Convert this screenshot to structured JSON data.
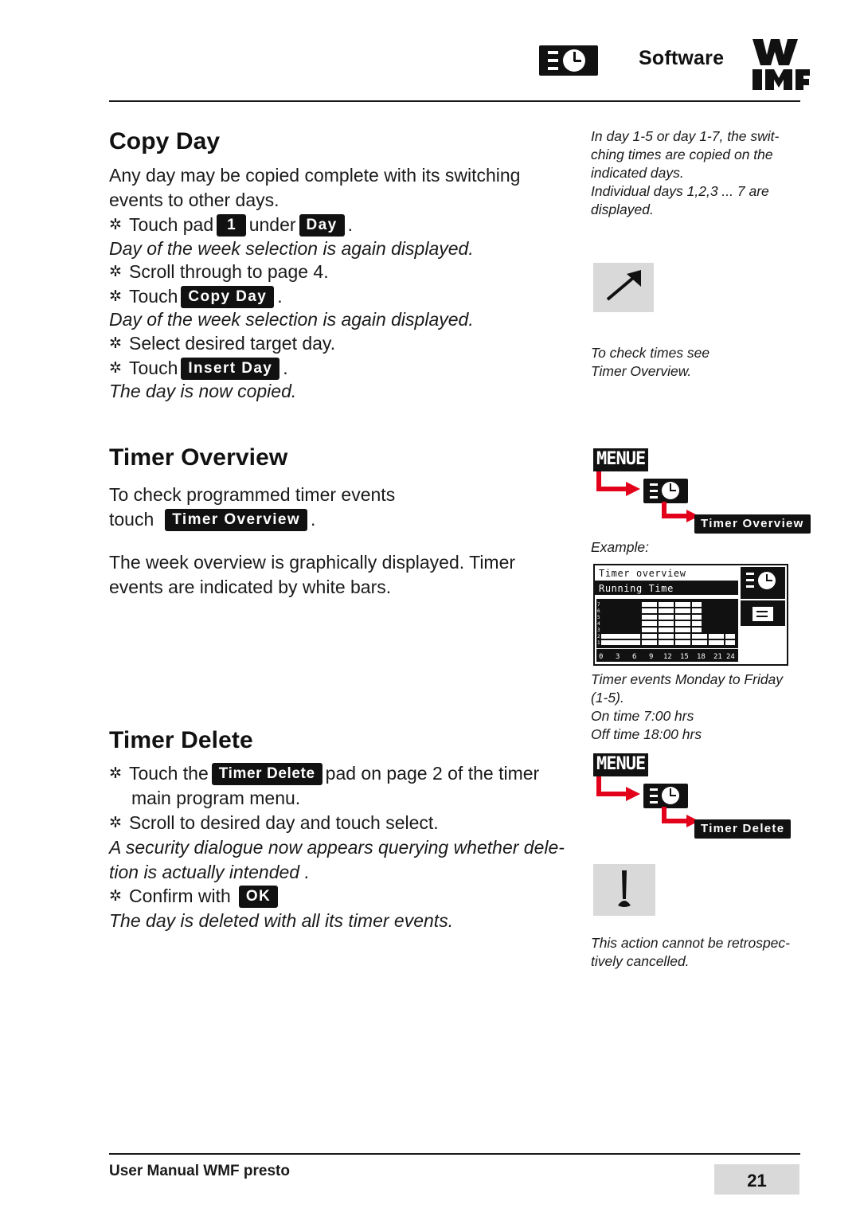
{
  "header": {
    "title": "Software",
    "icon_name": "menu-clock-icon",
    "logo_text": "WMF"
  },
  "sections": {
    "copy_day": {
      "heading": "Copy Day",
      "intro_line1": "Any day may be copied complete with its switching",
      "intro_line2": "events to other days.",
      "steps": {
        "s1_pre": "Touch pad",
        "s1_pad": "1",
        "s1_mid": "under",
        "s1_pad2": "Day",
        "s1_post": ".",
        "note1": "Day of the week selection is again displayed.",
        "s2": "Scroll through to page 4.",
        "s3_pre": "Touch",
        "s3_pad": "Copy Day",
        "s3_post": ".",
        "note2": "Day of the week selection is again displayed.",
        "s4": "Select desired target day.",
        "s5_pre": "Touch",
        "s5_pad": "Insert Day",
        "s5_post": ".",
        "note3": "The day is now copied."
      },
      "margin_note1_l1": "In day 1-5 or day 1-7, the swit-",
      "margin_note1_l2": "ching times are copied on the",
      "margin_note1_l3": "indicated days.",
      "margin_note1_l4": "Individual days 1,2,3 ... 7 are",
      "margin_note1_l5": "displayed.",
      "margin_note2_l1": "To check times see",
      "margin_note2_l2": "Timer Overview.",
      "arrow_icon": "diagonal-arrow-icon"
    },
    "timer_overview": {
      "heading": "Timer Overview",
      "p1_l1": "To check programmed timer events",
      "p1_pre": "touch",
      "p1_pad": "Timer Overview",
      "p1_post": ".",
      "p2_l1": "The week overview is graphically displayed.  Timer",
      "p2_l2": "events are indicated by white bars.",
      "nav": {
        "menue": "MENUE",
        "icon": "menu-clock-icon",
        "target": "Timer Overview"
      },
      "example_label": "Example:",
      "lcd": {
        "title": "Timer overview",
        "subtitle": "Running Time",
        "row_labels": [
          "7",
          "6",
          "5",
          "4",
          "3",
          "2",
          "1"
        ],
        "x_ticks": [
          "0",
          "3",
          "6",
          "9",
          "12",
          "15",
          "18",
          "21",
          "24"
        ]
      },
      "margin_note_l1": "Timer events Monday to Friday",
      "margin_note_l2": "(1-5).",
      "margin_note_l3": "On time 7:00 hrs",
      "margin_note_l4": "Off time 18:00 hrs"
    },
    "timer_delete": {
      "heading": "Timer Delete",
      "s1_pre": "Touch the",
      "s1_pad": "Timer Delete",
      "s1_post": "pad on page 2 of the timer",
      "s1_cont": "main program menu.",
      "s2": "Scroll to desired day and touch select.",
      "note1_l1": "A security dialogue now appears querying whether dele-",
      "note1_l2": "tion is actually intended .",
      "s3_pre": "Confirm with",
      "s3_pad": "OK",
      "note2": "The day is deleted with all its timer events.",
      "nav": {
        "menue": "MENUE",
        "icon": "menu-clock-icon",
        "target": "Timer Delete"
      },
      "warning_icon": "exclamation-icon",
      "margin_note_l1": "This action cannot be retrospec-",
      "margin_note_l2": "tively cancelled."
    }
  },
  "footer": {
    "text": "User Manual WMF presto",
    "page_number": "21"
  },
  "chart_data": {
    "type": "bar",
    "title": "Timer overview",
    "subtitle": "Running Time",
    "categories": [
      "1",
      "2",
      "3",
      "4",
      "5",
      "6",
      "7"
    ],
    "x_ticks": [
      "0",
      "3",
      "6",
      "9",
      "12",
      "15",
      "18",
      "21",
      "24"
    ],
    "xlim": [
      0,
      24
    ],
    "on_time": 7,
    "off_time": 18,
    "active_days": [
      "1",
      "2",
      "3",
      "4",
      "5"
    ]
  },
  "colors": {
    "accent_red": "#e2001a",
    "ink": "#1a1a1a",
    "gray_box": "#d9d9d9"
  }
}
